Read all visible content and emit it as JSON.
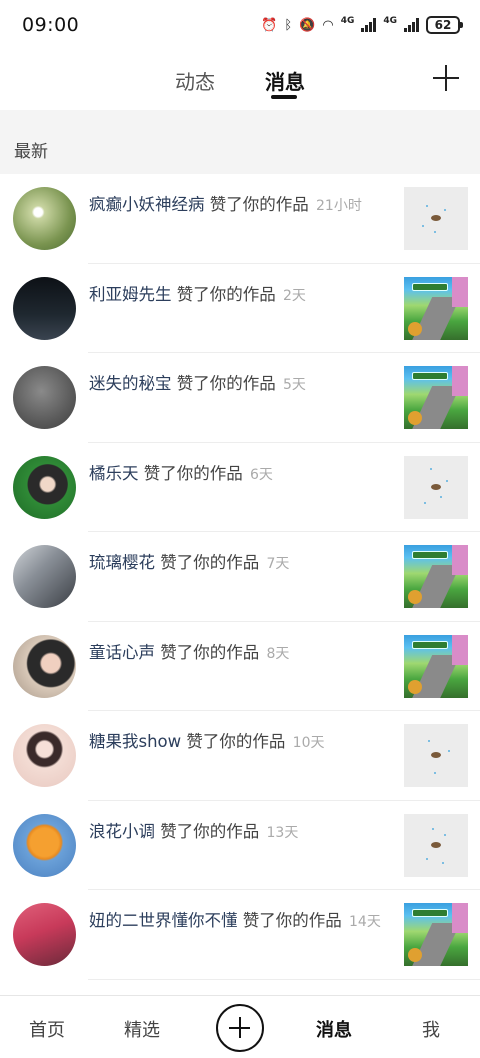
{
  "status": {
    "time": "09:00",
    "signal1": "4G",
    "signal2": "4G",
    "battery": "62"
  },
  "header": {
    "tabs": [
      {
        "label": "动态"
      },
      {
        "label": "消息"
      }
    ]
  },
  "section": {
    "title": "最新"
  },
  "notifications": [
    {
      "user": "疯癫小妖神经病",
      "action": "赞了你的作品",
      "time": "21小时",
      "avatar_color": "#a8b880",
      "thumb": "light"
    },
    {
      "user": "利亚姆先生",
      "action": "赞了你的作品",
      "time": "2天",
      "avatar_color": "#1a1f24",
      "thumb": "game"
    },
    {
      "user": "迷失的秘宝",
      "action": "赞了你的作品",
      "time": "5天",
      "avatar_color": "#6a6a6a",
      "thumb": "game"
    },
    {
      "user": "橘乐天",
      "action": "赞了你的作品",
      "time": "6天",
      "avatar_color": "#2f8a36",
      "thumb": "light"
    },
    {
      "user": "琉璃樱花",
      "action": "赞了你的作品",
      "time": "7天",
      "avatar_color": "#9aa0a8",
      "thumb": "game"
    },
    {
      "user": "童话心声",
      "action": "赞了你的作品",
      "time": "8天",
      "avatar_color": "#c8b8a8",
      "thumb": "game"
    },
    {
      "user": "糖果我show",
      "action": "赞了你的作品",
      "time": "10天",
      "avatar_color": "#f0d8d0",
      "thumb": "light"
    },
    {
      "user": "浪花小调",
      "action": "赞了你的作品",
      "time": "13天",
      "avatar_color": "#e8a040",
      "thumb": "light"
    },
    {
      "user": "妞的二世界懂你不懂",
      "action": "赞了你的作品",
      "time": "14天",
      "avatar_color": "#c84a6a",
      "thumb": "game"
    }
  ],
  "bottom_nav": {
    "home": "首页",
    "featured": "精选",
    "messages": "消息",
    "me": "我"
  }
}
